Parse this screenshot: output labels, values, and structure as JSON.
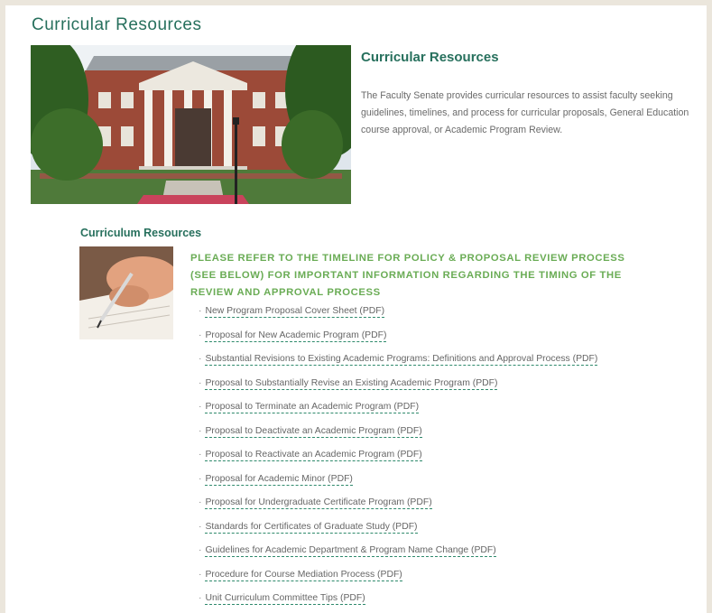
{
  "page_title": "Curricular Resources",
  "hero": {
    "heading": "Curricular Resources",
    "text": "The Faculty Senate provides curricular resources to assist faculty seeking guidelines, timelines, and process for curricular proposals, General Education course approval, or Academic Program Review."
  },
  "section": {
    "heading": "Curriculum Resources",
    "notice": "PLEASE REFER TO THE TIMELINE FOR POLICY & PROPOSAL REVIEW PROCESS (SEE BELOW) FOR IMPORTANT INFORMATION REGARDING THE TIMING OF THE REVIEW AND APPROVAL PROCESS",
    "bullet": "·",
    "documents": [
      {
        "label": "New Program Proposal Cover Sheet (PDF)"
      },
      {
        "label": "Proposal for New Academic Program (PDF)"
      },
      {
        "label": "Substantial Revisions to Existing Academic Programs: Definitions and Approval Process (PDF)"
      },
      {
        "label": "Proposal to Substantially Revise an Existing Academic Program (PDF)"
      },
      {
        "label": "Proposal to Terminate an Academic Program (PDF)"
      },
      {
        "label": "Proposal to Deactivate an Academic Program (PDF)"
      },
      {
        "label": "Proposal to Reactivate an Academic Program (PDF)"
      },
      {
        "label": "Proposal for Academic Minor (PDF)"
      },
      {
        "label": "Proposal for Undergraduate Certificate Program (PDF)"
      },
      {
        "label": "Standards for Certificates of Graduate Study (PDF)"
      },
      {
        "label": "Guidelines for Academic Department & Program Name Change (PDF)"
      },
      {
        "label": "Procedure for Course Mediation Process (PDF)"
      },
      {
        "label": "Unit Curriculum Committee Tips (PDF)"
      }
    ]
  },
  "colors": {
    "brand_green": "#27705d",
    "notice_green": "#6aac55",
    "page_bg": "#ebe6dc"
  }
}
